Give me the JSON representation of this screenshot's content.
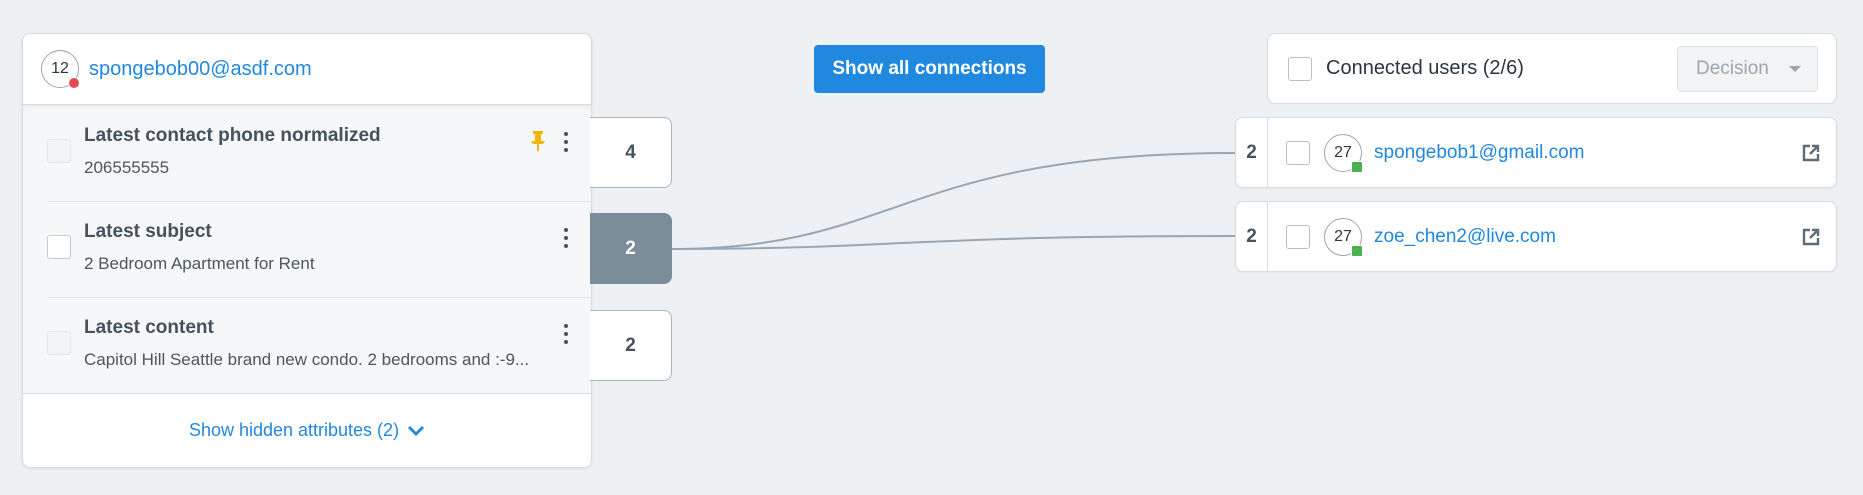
{
  "primary_user": {
    "score": "12",
    "email": "spongebob00@asdf.com"
  },
  "attributes": [
    {
      "title": "Latest contact phone normalized",
      "value": "206555555",
      "pinned": true,
      "count": "4"
    },
    {
      "title": "Latest subject",
      "value": "2 Bedroom Apartment for Rent",
      "pinned": false,
      "count": "2"
    },
    {
      "title": "Latest content",
      "value": "Capitol Hill Seattle brand new condo. 2 bedrooms and :-9...",
      "pinned": false,
      "count": "2"
    }
  ],
  "show_hidden_label": "Show hidden attributes (2)",
  "show_all_label": "Show all connections",
  "connected": {
    "label": "Connected users (2/6)",
    "decision_label": "Decision",
    "users": [
      {
        "count": "2",
        "score": "27",
        "email": "spongebob1@gmail.com"
      },
      {
        "count": "2",
        "score": "27",
        "email": "zoe_chen2@live.com"
      }
    ]
  },
  "colors": {
    "accent": "#2188e0",
    "risk_high": "#e5484d",
    "risk_low": "#4caf50",
    "pin": "#f2b705",
    "active_tab": "#7a8d99"
  }
}
